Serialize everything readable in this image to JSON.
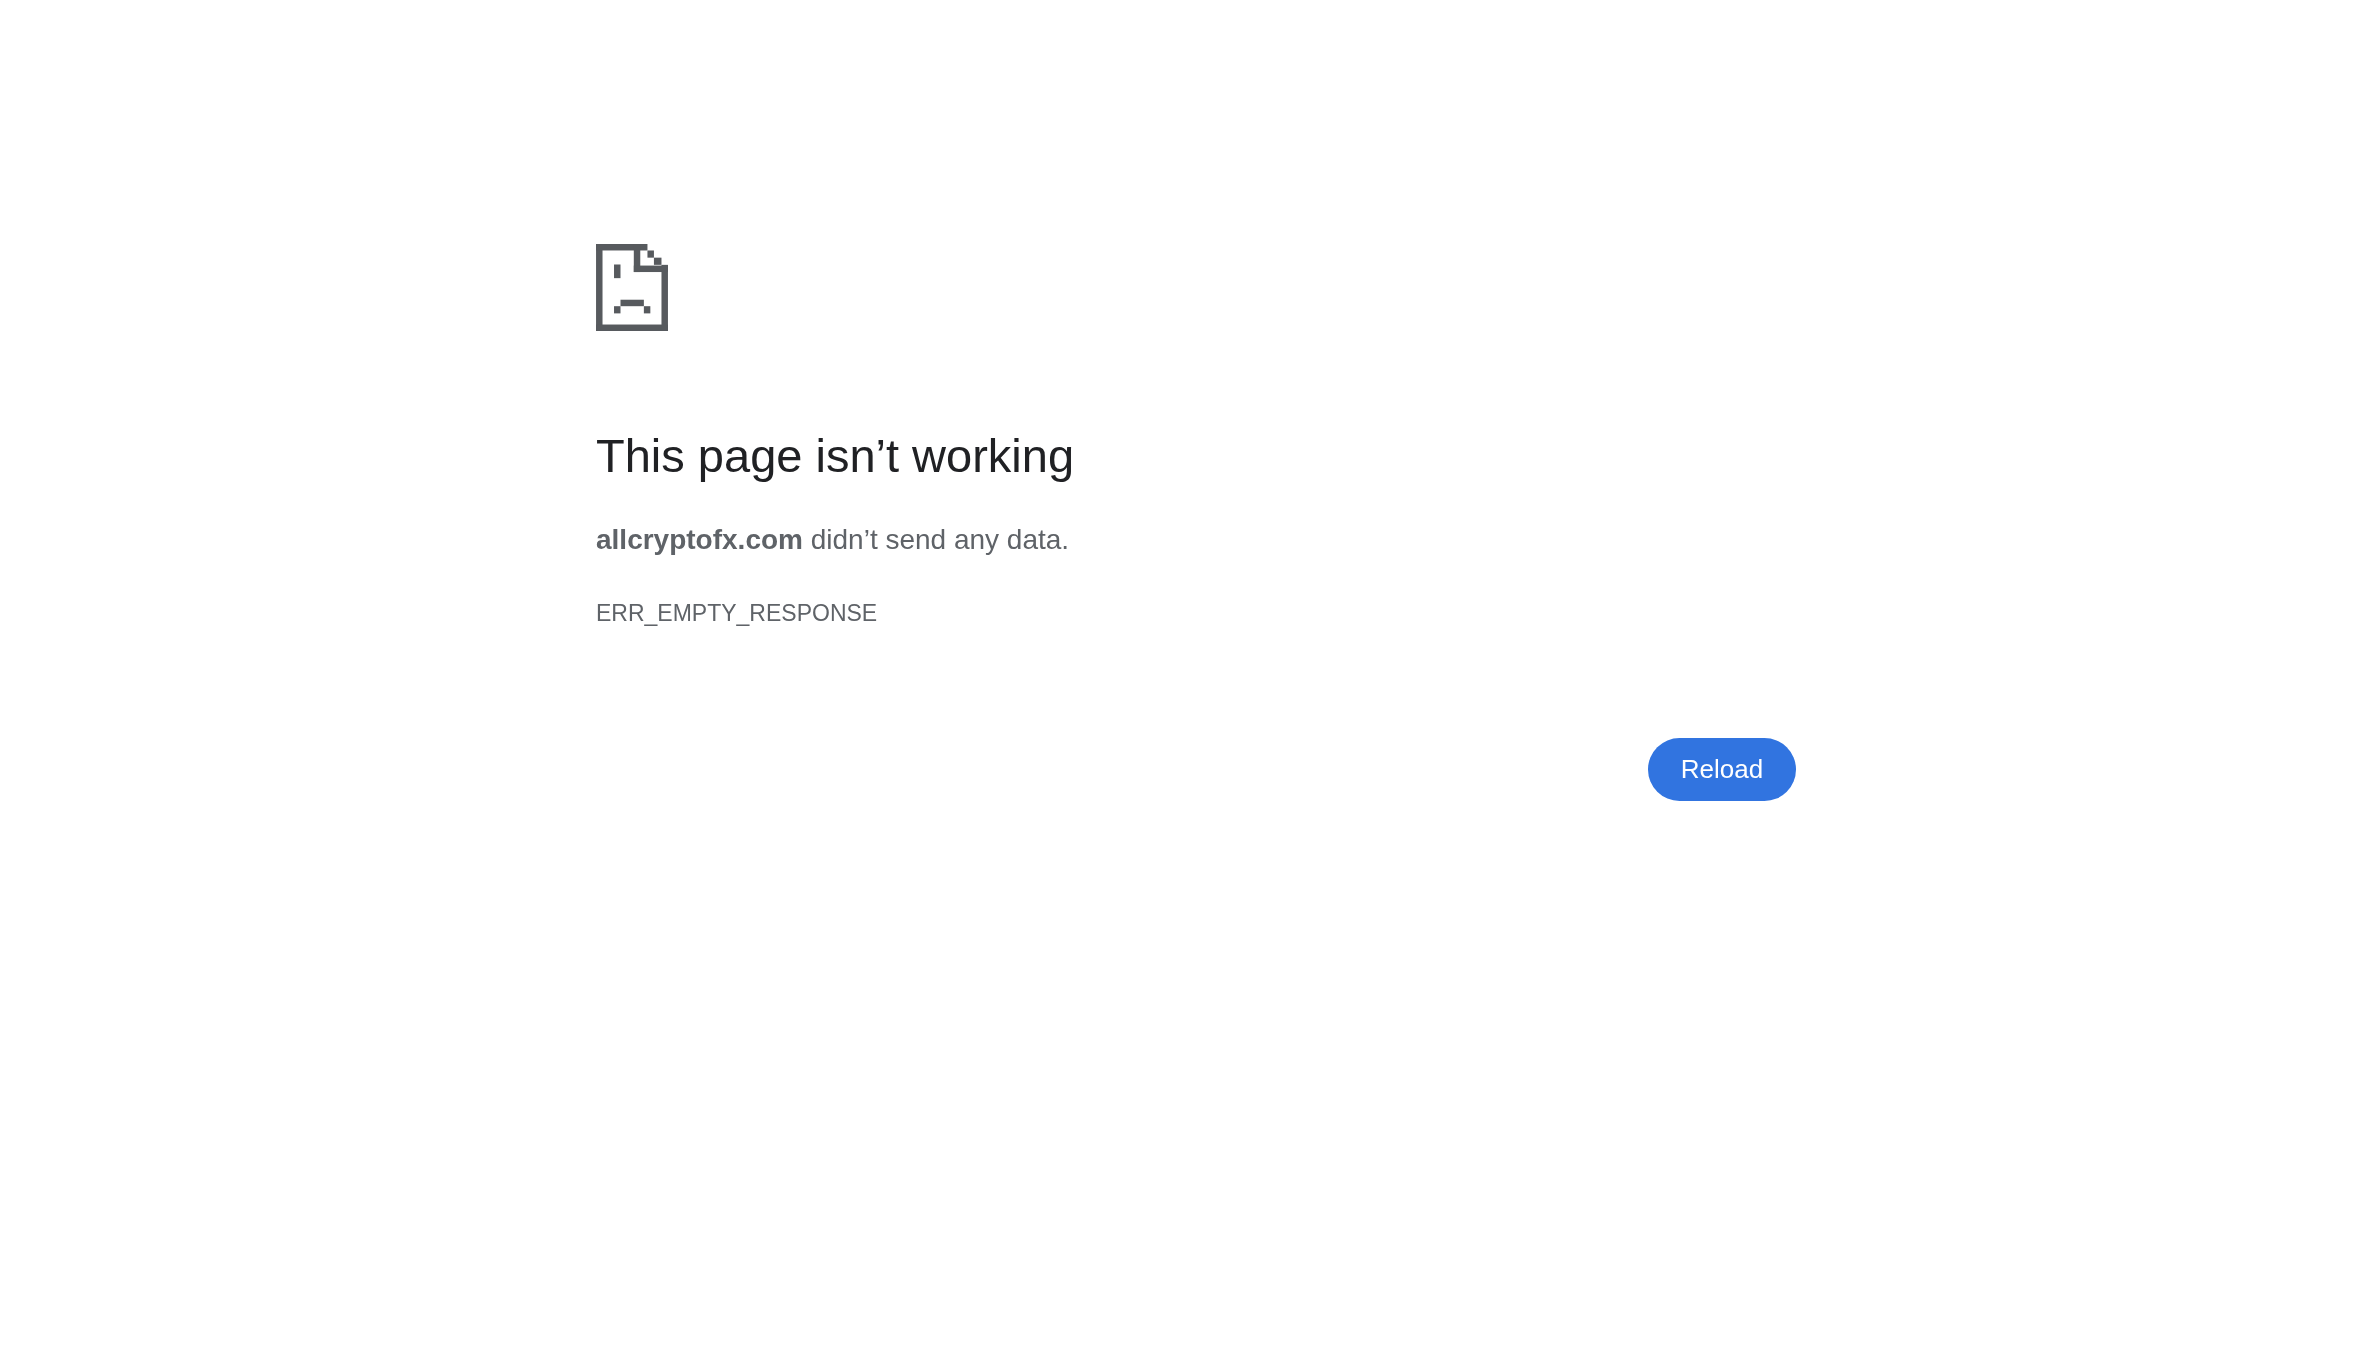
{
  "heading": "This page isn’t working",
  "message": "**allcryptofx.com** didn’t send any data.",
  "error_code": "ERR_EMPTY_RESPONSE",
  "buttons": [
    {
      "label": "Reload"
    }
  ]
}
